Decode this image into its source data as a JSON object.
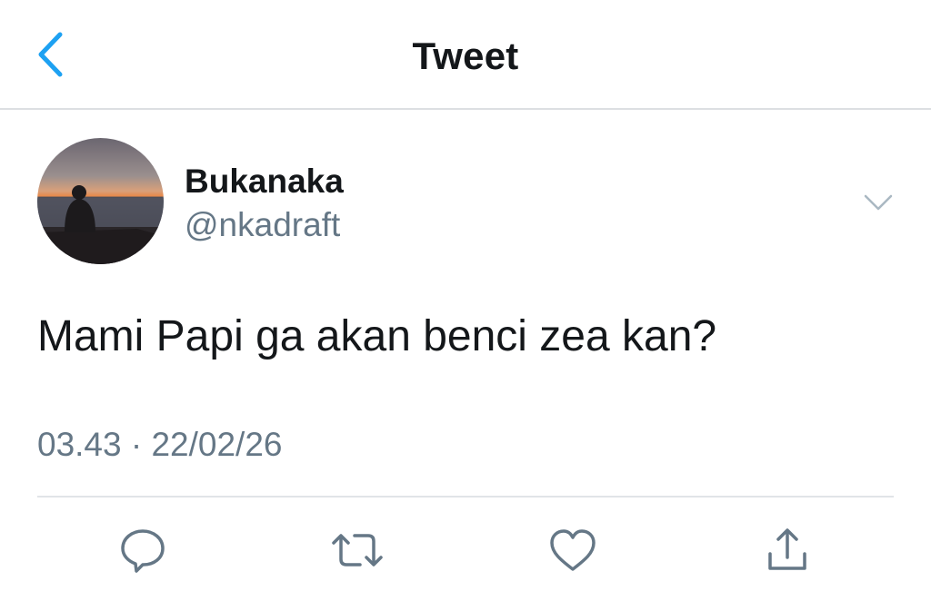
{
  "header": {
    "title": "Tweet",
    "back_icon": "chevron-left-icon"
  },
  "tweet": {
    "author": {
      "display_name": "Bukanaka",
      "handle": "@nkadraft"
    },
    "text": "Mami Papi ga akan benci zea kan?",
    "timestamp": "03.43 · 22/02/26"
  },
  "actions": [
    {
      "name": "reply",
      "icon": "reply-bubble-icon"
    },
    {
      "name": "retweet",
      "icon": "retweet-icon"
    },
    {
      "name": "like",
      "icon": "heart-icon"
    },
    {
      "name": "share",
      "icon": "share-icon"
    }
  ],
  "colors": {
    "accent": "#1da1f2",
    "secondary_text": "#657786",
    "primary_text": "#14171a",
    "divider": "#e1e4e8"
  }
}
